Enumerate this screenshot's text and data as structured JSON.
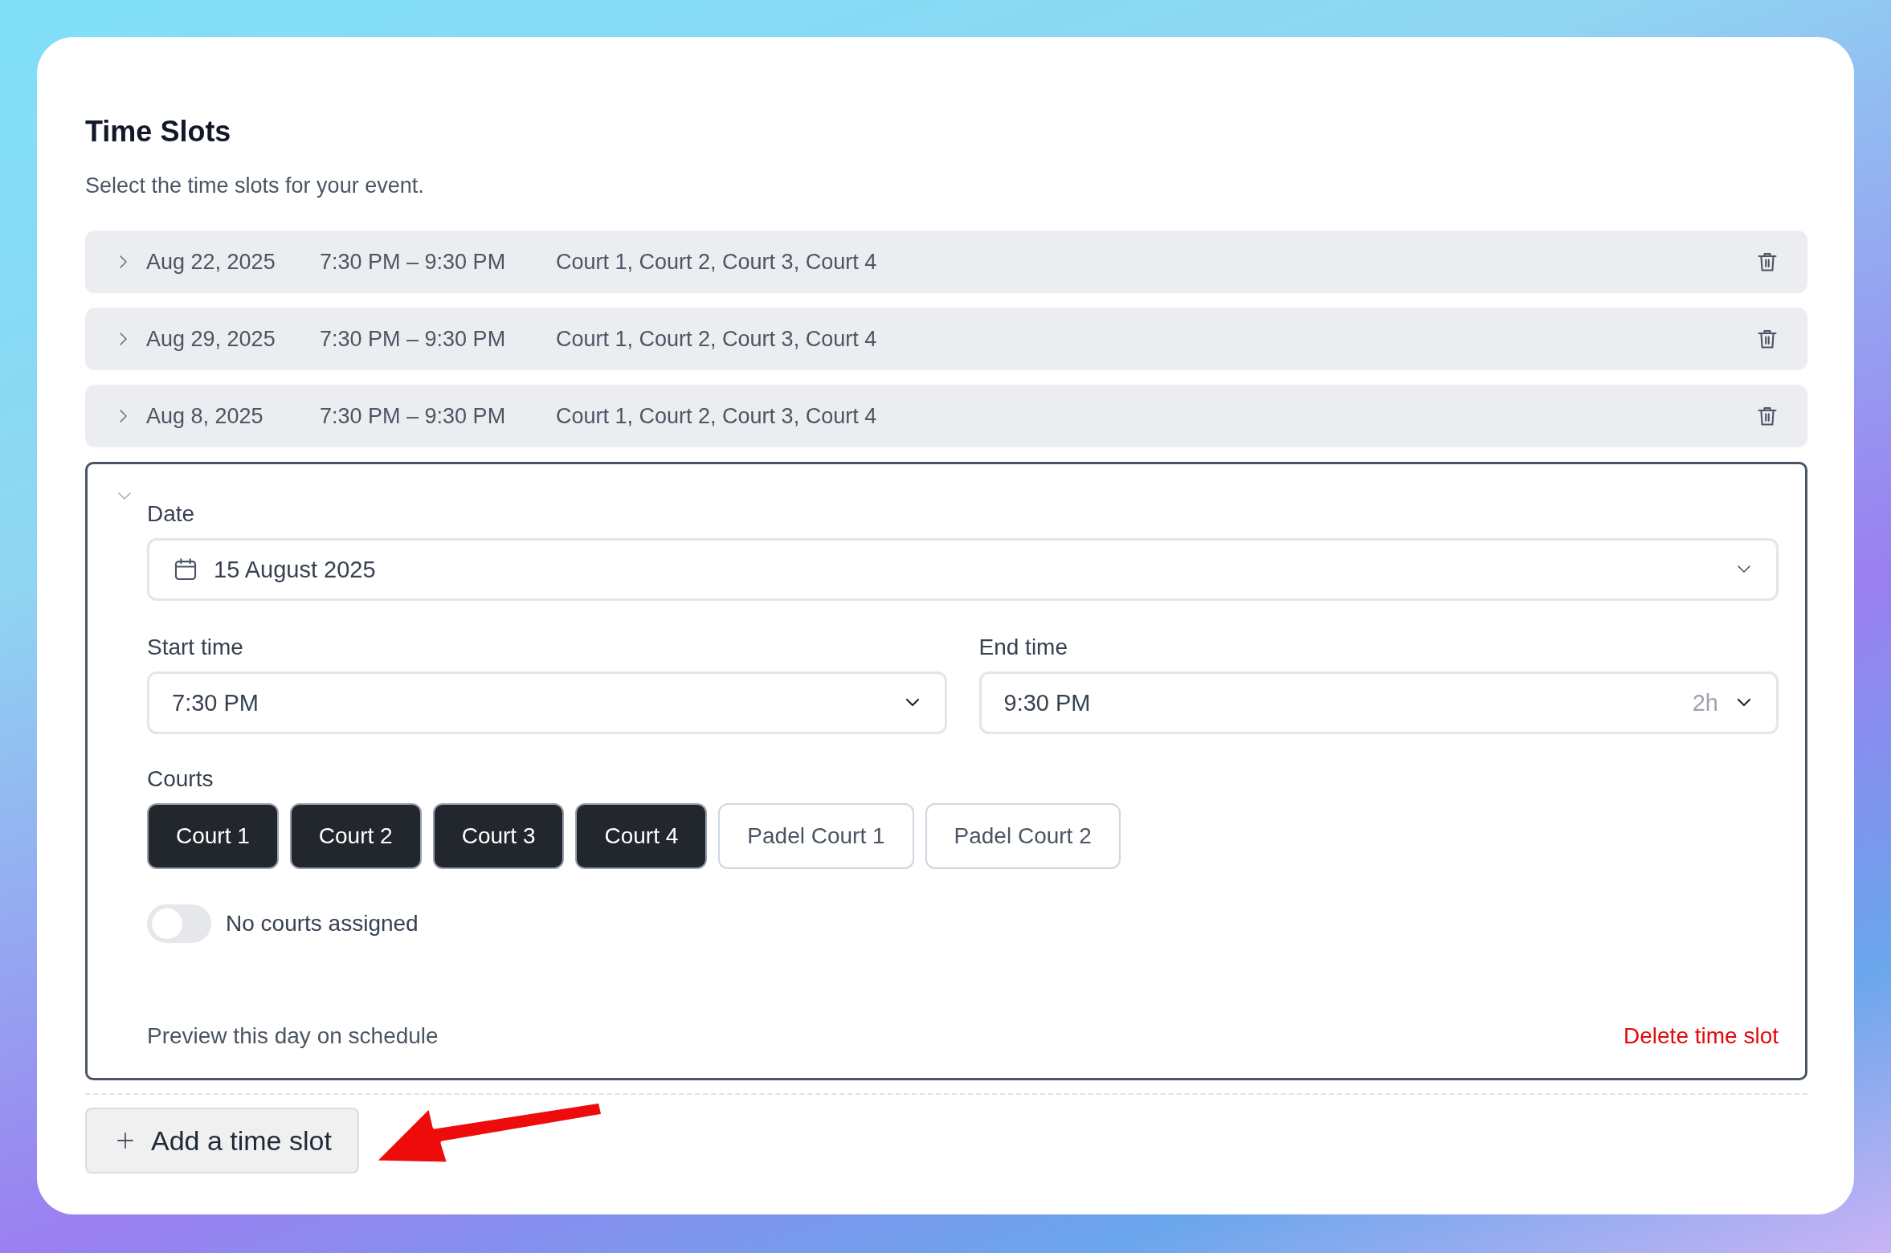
{
  "title": "Time Slots",
  "subtitle": "Select the time slots for your event.",
  "time_slots": [
    {
      "date": "Aug 22, 2025",
      "time": "7:30 PM – 9:30 PM",
      "courts": "Court 1, Court 2, Court 3, Court 4",
      "expanded": false
    },
    {
      "date": "Aug 29, 2025",
      "time": "7:30 PM – 9:30 PM",
      "courts": "Court 1, Court 2, Court 3, Court 4",
      "expanded": false
    },
    {
      "date": "Aug 8, 2025",
      "time": "7:30 PM – 9:30 PM",
      "courts": "Court 1, Court 2, Court 3, Court 4",
      "expanded": false
    }
  ],
  "editor": {
    "expanded": true,
    "date_label": "Date",
    "date_value": "15 August 2025",
    "start_label": "Start time",
    "start_value": "7:30 PM",
    "end_label": "End time",
    "end_value": "9:30 PM",
    "duration": "2h",
    "courts_label": "Courts",
    "courts": [
      {
        "label": "Court 1",
        "selected": true
      },
      {
        "label": "Court 2",
        "selected": true
      },
      {
        "label": "Court 3",
        "selected": true
      },
      {
        "label": "Court 4",
        "selected": true
      },
      {
        "label": "Padel Court 1",
        "selected": false
      },
      {
        "label": "Padel Court 2",
        "selected": false
      }
    ],
    "no_courts_toggle": {
      "label": "No courts assigned",
      "on": false
    },
    "preview_link": "Preview this day on schedule",
    "delete_link": "Delete time slot"
  },
  "add_button": "Add a time slot"
}
